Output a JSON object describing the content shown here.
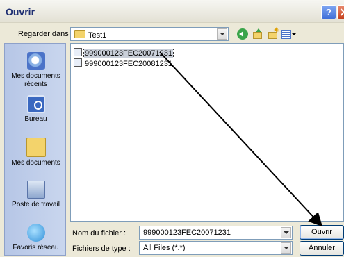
{
  "window": {
    "title": "Ouvrir",
    "help_label": "?"
  },
  "lookin": {
    "label": "Regarder dans :",
    "value": "Test1"
  },
  "toolbar": {
    "icons": [
      "back-icon",
      "up-folder-icon",
      "new-folder-icon",
      "views-menu-icon"
    ]
  },
  "places": [
    {
      "label": "Mes documents récents",
      "icon": "recent-documents-icon"
    },
    {
      "label": "Bureau",
      "icon": "desktop-icon"
    },
    {
      "label": "Mes documents",
      "icon": "my-documents-icon"
    },
    {
      "label": "Poste de travail",
      "icon": "my-computer-icon"
    },
    {
      "label": "Favoris réseau",
      "icon": "network-places-icon"
    }
  ],
  "files": [
    {
      "name": "999000123FEC20071231",
      "selected": true
    },
    {
      "name": "999000123FEC20081231",
      "selected": false
    }
  ],
  "filename": {
    "label": "Nom du fichier :",
    "value": "999000123FEC20071231"
  },
  "filetype": {
    "label": "Fichiers de type :",
    "value": "All Files (*.*)"
  },
  "buttons": {
    "ok": "Ouvrir",
    "cancel": "Annuler"
  },
  "colors": {
    "accent": "#1f2f72",
    "selection": "#c9cfd9",
    "arrow": "#000000"
  }
}
